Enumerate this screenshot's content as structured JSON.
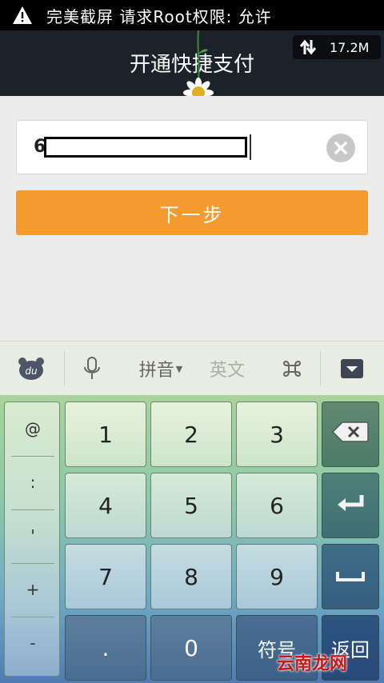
{
  "status_bar": {
    "icon": "warning-icon",
    "text": "完美截屏 请求Root权限: 允许"
  },
  "title_bar": {
    "title": "开通快捷支付",
    "speed_icon": "sync-arrows-icon",
    "speed_text": "17.2M"
  },
  "form": {
    "input_value": "6",
    "clear_icon": "clear-icon",
    "next_label": "下一步"
  },
  "keyboard_toolbar": {
    "logo_icon": "du-logo-icon",
    "voice_icon": "microphone-icon",
    "pinyin_label": "拼音",
    "english_label": "英文",
    "command_icon": "command-icon",
    "hide_icon": "hide-keyboard-icon"
  },
  "keyboard": {
    "symbols": [
      "@",
      ":",
      "'",
      "+",
      "-"
    ],
    "rows": [
      [
        "1",
        "2",
        "3"
      ],
      [
        "4",
        "5",
        "6"
      ],
      [
        "7",
        "8",
        "9"
      ],
      [
        ".",
        "0"
      ]
    ],
    "symbol_key": "符号",
    "back_key": "返回",
    "backspace_icon": "backspace-icon",
    "enter_icon": "enter-icon",
    "space_icon": "space-icon"
  },
  "watermark": "云南龙网",
  "colors": {
    "accent": "#f59a2f",
    "title_bar": "#1c2229",
    "watermark": "#c81818"
  }
}
